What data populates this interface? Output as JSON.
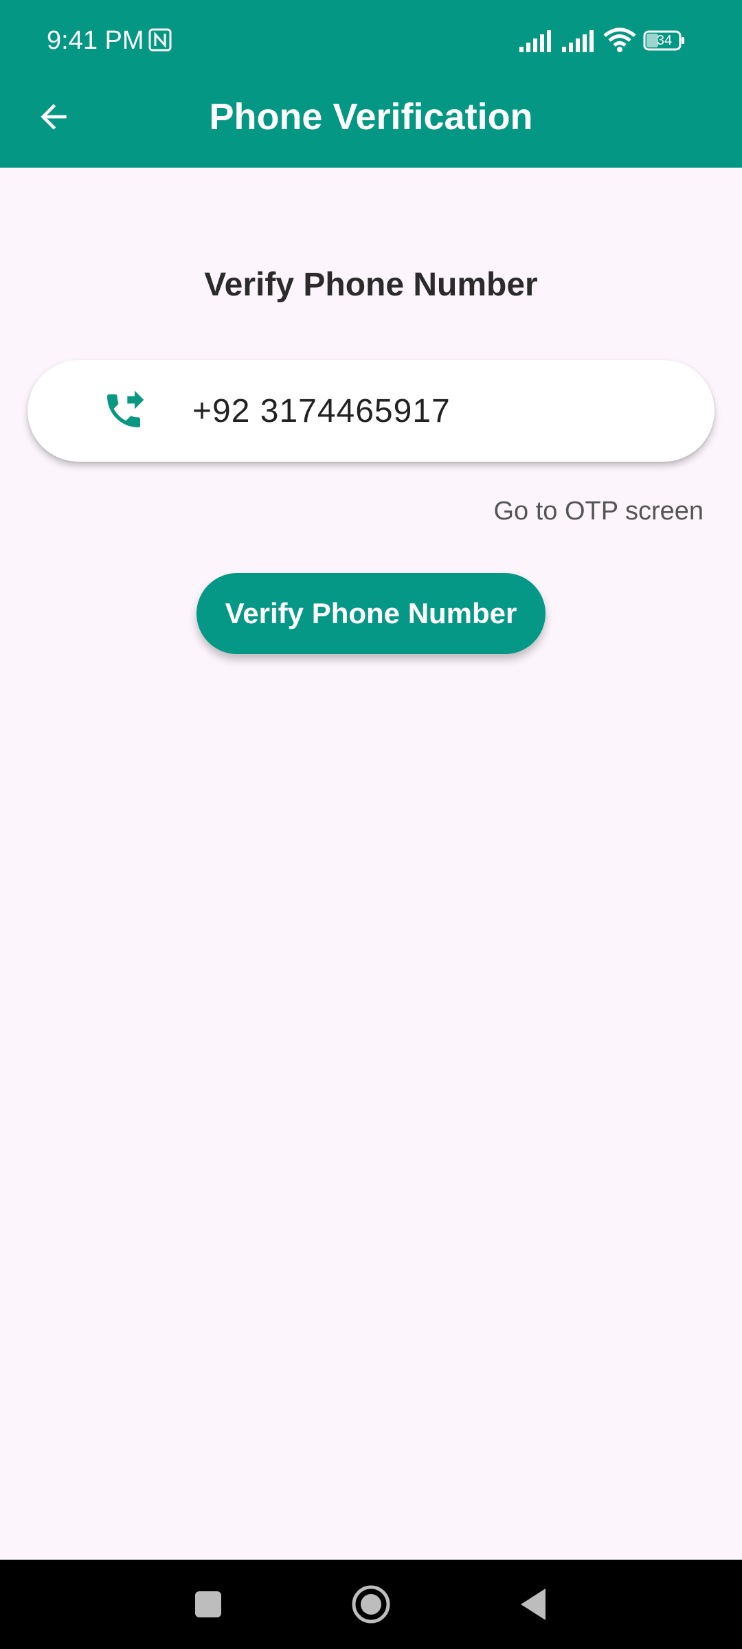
{
  "status_bar": {
    "time": "9:41 PM",
    "battery": "34",
    "icons": [
      "nfc-icon",
      "signal-icon",
      "signal-icon",
      "wifi-icon",
      "battery-icon"
    ]
  },
  "app_bar": {
    "title": "Phone Verification",
    "back_icon": "arrow-back-icon"
  },
  "content": {
    "heading": "Verify Phone Number",
    "phone_field": {
      "value": "+92 3174465917",
      "icon": "phone-forwarded-icon"
    },
    "otp_link": "Go to OTP screen",
    "verify_button": "Verify Phone Number"
  },
  "nav_bar": {
    "buttons": [
      "recent-apps-icon",
      "home-icon",
      "back-icon"
    ]
  },
  "colors": {
    "primary": "#039784",
    "background": "#FCF6FC",
    "accent_icon": "#0A9782"
  }
}
